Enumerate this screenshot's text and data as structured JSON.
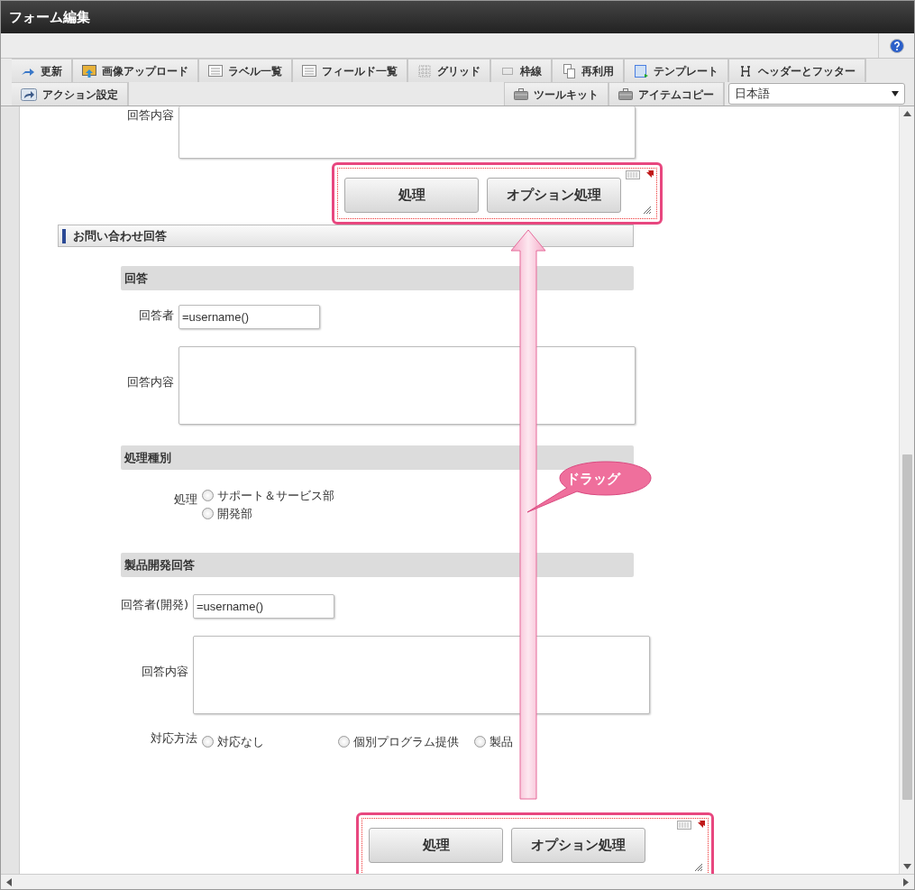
{
  "window": {
    "title": "フォーム編集"
  },
  "toolbar": {
    "row1": [
      {
        "label": "更新"
      },
      {
        "label": "画像アップロード"
      },
      {
        "label": "ラベル一覧"
      },
      {
        "label": "フィールド一覧"
      },
      {
        "label": "グリッド"
      },
      {
        "label": "枠線"
      },
      {
        "label": "再利用"
      },
      {
        "label": "テンプレート"
      },
      {
        "label": "ヘッダーとフッター"
      }
    ],
    "row2_left": [
      {
        "label": "アクション設定"
      }
    ],
    "row2_right": [
      {
        "label": "ツールキット"
      },
      {
        "label": "アイテムコピー"
      }
    ],
    "language": {
      "value": "日本語"
    }
  },
  "form": [
    {
      "kind": "textarea",
      "label": "回答内容"
    },
    {
      "kind": "buttons",
      "highlighted": true,
      "buttons": [
        "処理",
        "オプション処理"
      ]
    },
    {
      "kind": "section",
      "title": "お問い合わせ回答"
    },
    {
      "kind": "subsection",
      "title": "回答"
    },
    {
      "kind": "text",
      "label": "回答者",
      "value": "=username()"
    },
    {
      "kind": "textarea",
      "label": "回答内容"
    },
    {
      "kind": "subsection",
      "title": "処理種別"
    },
    {
      "kind": "radios",
      "label": "処理",
      "options": [
        {
          "label": "サポート＆サービス部",
          "selected": false
        },
        {
          "label": "開発部",
          "selected": false
        }
      ]
    },
    {
      "kind": "subsection",
      "title": "製品開発回答"
    },
    {
      "kind": "text",
      "label": "回答者(開発)",
      "value": "=username()"
    },
    {
      "kind": "textarea",
      "label": "回答内容"
    },
    {
      "kind": "radios",
      "label": "対応方法",
      "options": [
        {
          "label": "対応なし",
          "selected": false
        },
        {
          "label": "個別プログラム提供",
          "selected": false
        },
        {
          "label": "製品",
          "selected": false
        }
      ]
    },
    {
      "kind": "buttons",
      "highlighted": true,
      "buttons": [
        "処理",
        "オプション処理"
      ]
    }
  ],
  "callout": {
    "text": "ドラッグ"
  }
}
